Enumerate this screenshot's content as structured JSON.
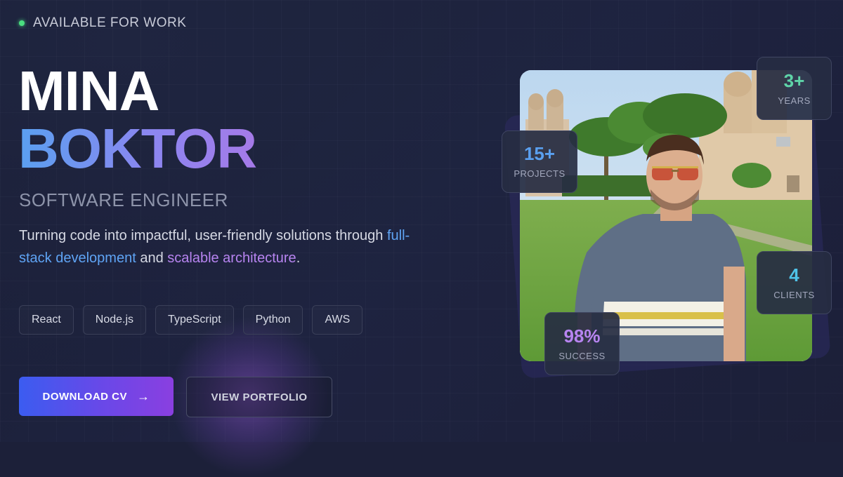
{
  "status": {
    "label": "AVAILABLE FOR WORK",
    "color": "#4ade80"
  },
  "hero": {
    "first_name": "MINA",
    "last_name": "BOKTOR",
    "role": "SOFTWARE ENGINEER",
    "tagline_start": "Turning code into impactful, user-friendly solutions through ",
    "tagline_highlight1": "full-stack development",
    "tagline_middle": " and ",
    "tagline_highlight2": "scalable architecture",
    "tagline_end": "."
  },
  "skills": [
    "React",
    "Node.js",
    "TypeScript",
    "Python",
    "AWS"
  ],
  "actions": {
    "download_label": "DOWNLOAD CV",
    "download_icon": "arrow-right-icon",
    "portfolio_label": "VIEW PORTFOLIO"
  },
  "stats": {
    "years": {
      "value": "3+",
      "label": "YEARS",
      "color": "#5fd4a8"
    },
    "projects": {
      "value": "15+",
      "label": "PROJECTS",
      "color": "#5aa0f0"
    },
    "clients": {
      "value": "4",
      "label": "CLIENTS",
      "color": "#4fc3e8"
    },
    "success": {
      "value": "98%",
      "label": "SUCCESS",
      "color": "#b784f0"
    }
  },
  "colors": {
    "background": "#1c2039",
    "accent_blue": "#5fa4f5",
    "accent_purple": "#b784f0"
  }
}
